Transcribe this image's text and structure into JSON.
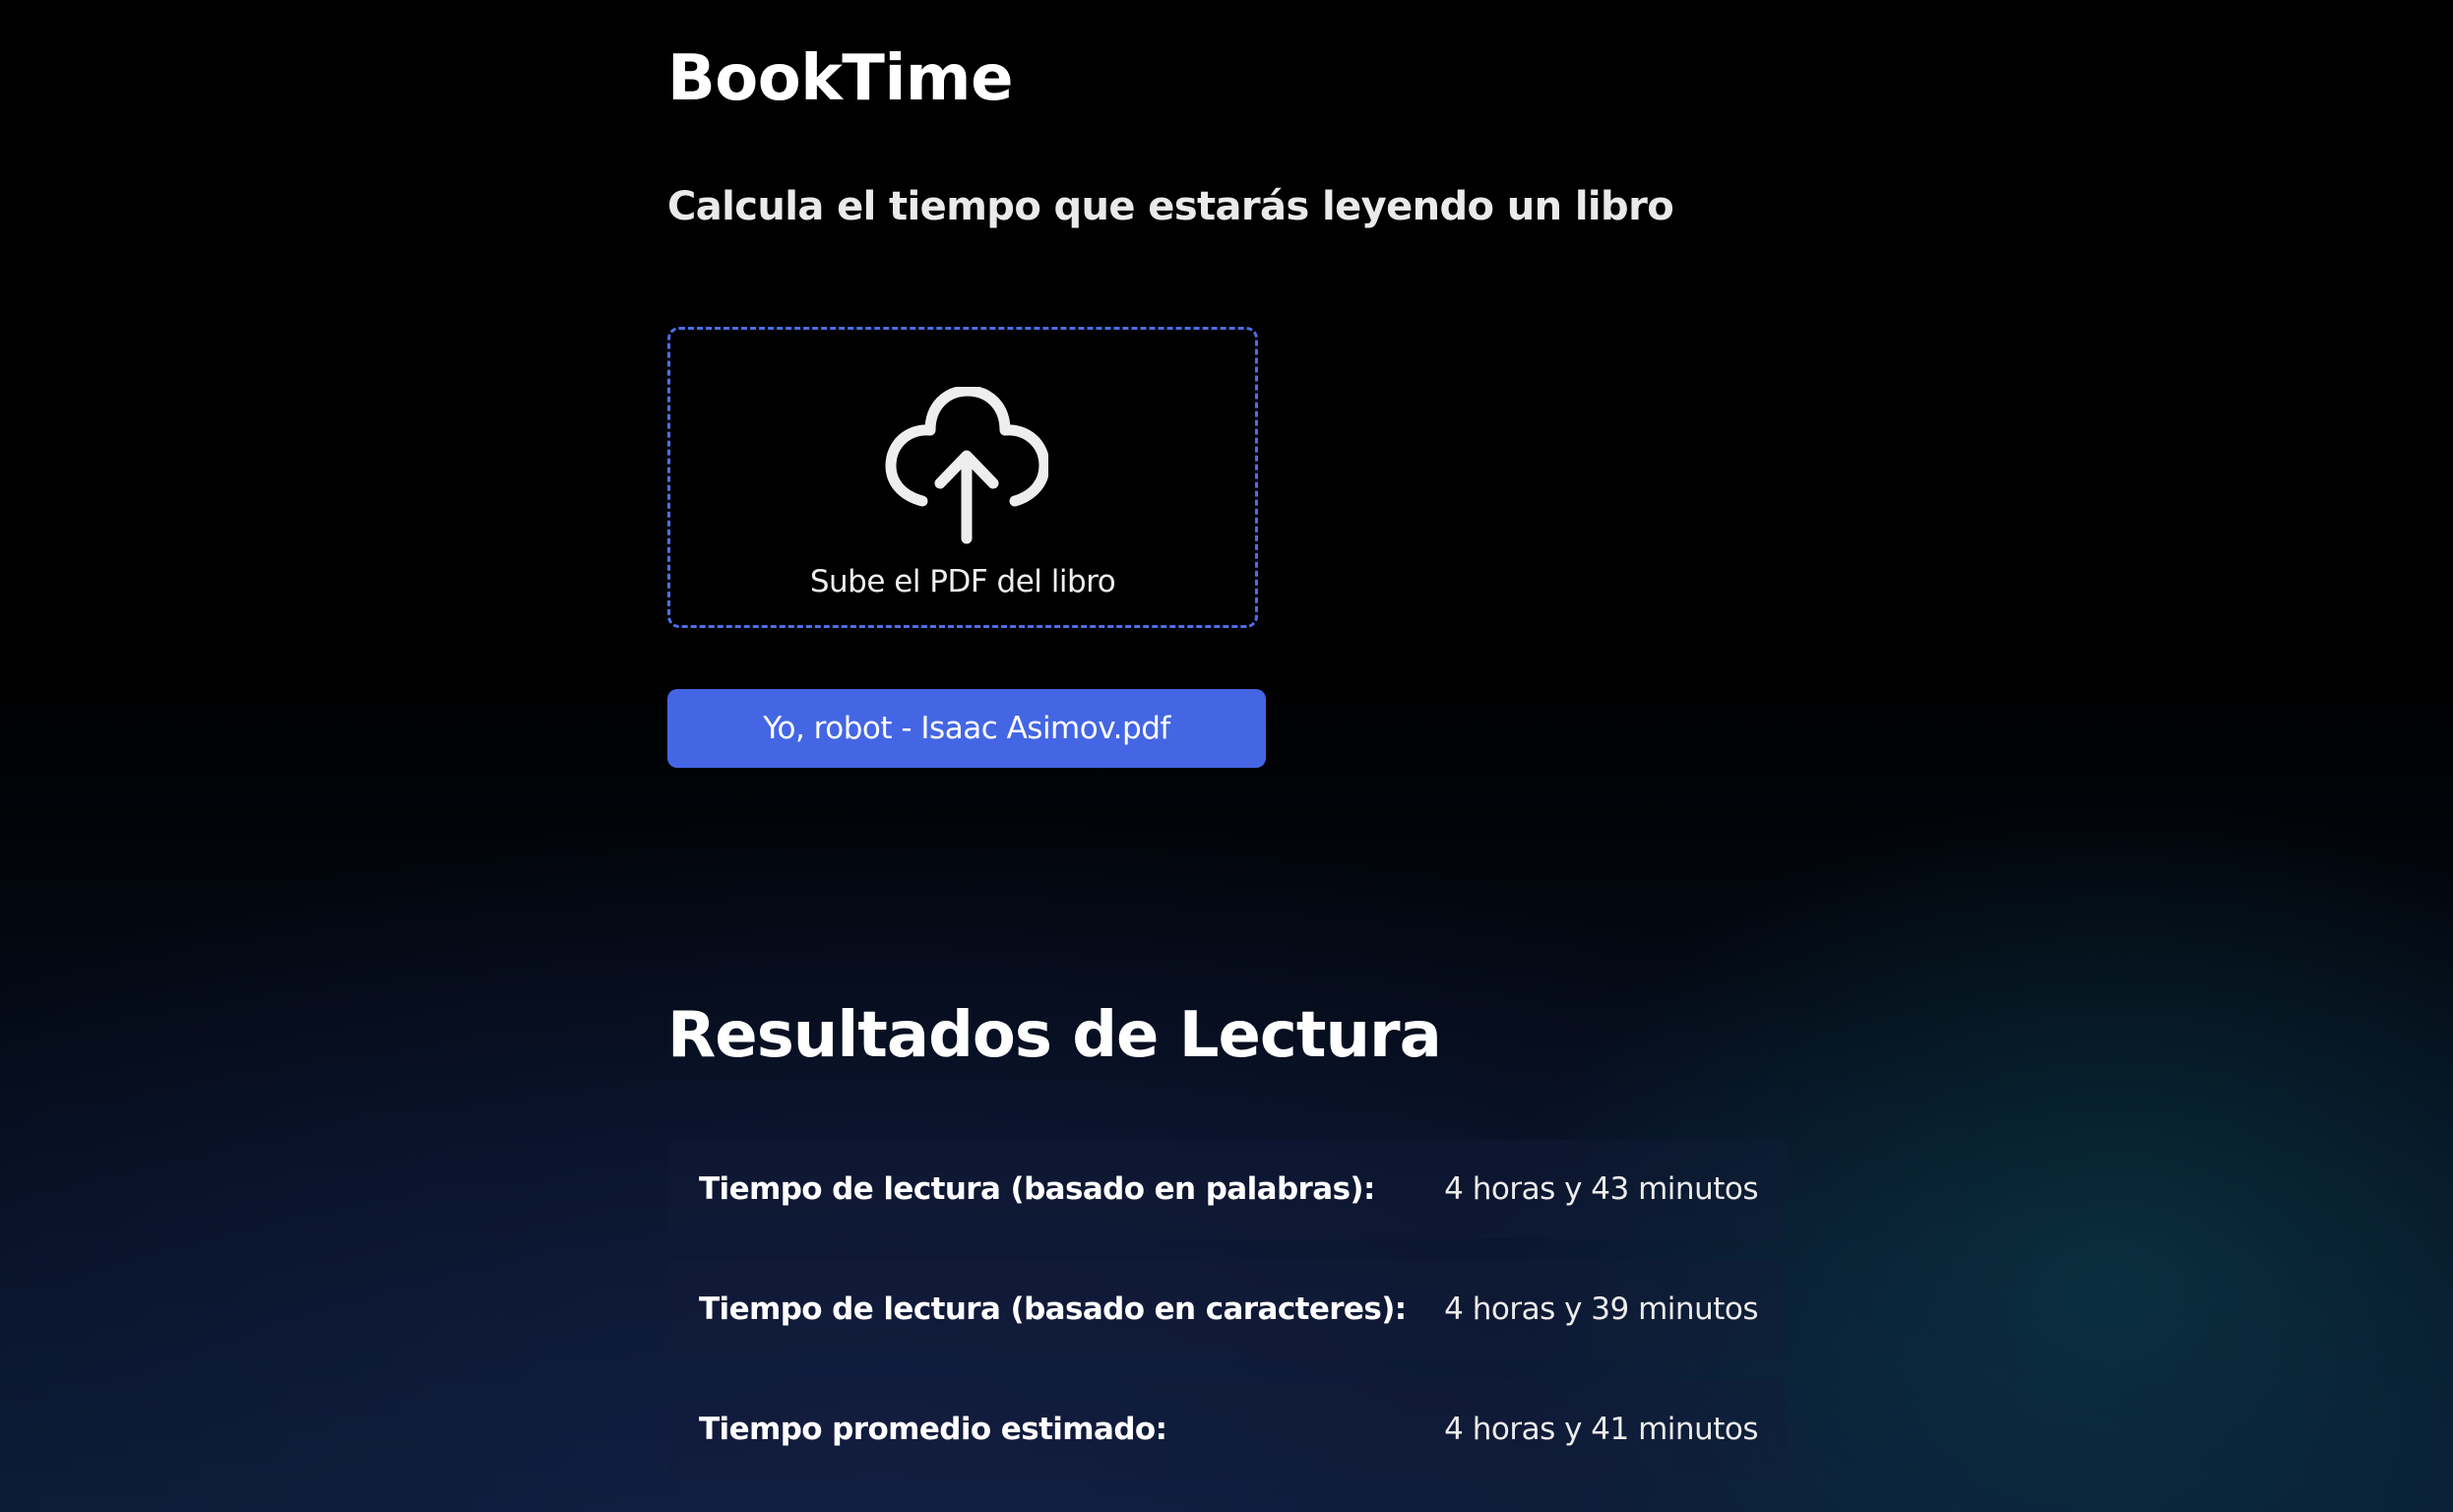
{
  "app": {
    "title": "BookTime",
    "subtitle": "Calcula el tiempo que estarás leyendo un libro"
  },
  "upload": {
    "icon": "cloud-upload-icon",
    "label": "Sube el PDF del libro",
    "border_color": "#4d6ee6"
  },
  "file": {
    "name": "Yo, robot - Isaac Asimov.pdf",
    "button_color": "#4466e4"
  },
  "results": {
    "title": "Resultados de Lectura",
    "rows": [
      {
        "label": "Tiempo de lectura (basado en palabras):",
        "value": "4 horas y 43 minutos"
      },
      {
        "label": "Tiempo de lectura (basado en caracteres):",
        "value": "4 horas y 39 minutos"
      },
      {
        "label": "Tiempo promedio estimado:",
        "value": "4 horas y 41 minutos"
      }
    ]
  }
}
